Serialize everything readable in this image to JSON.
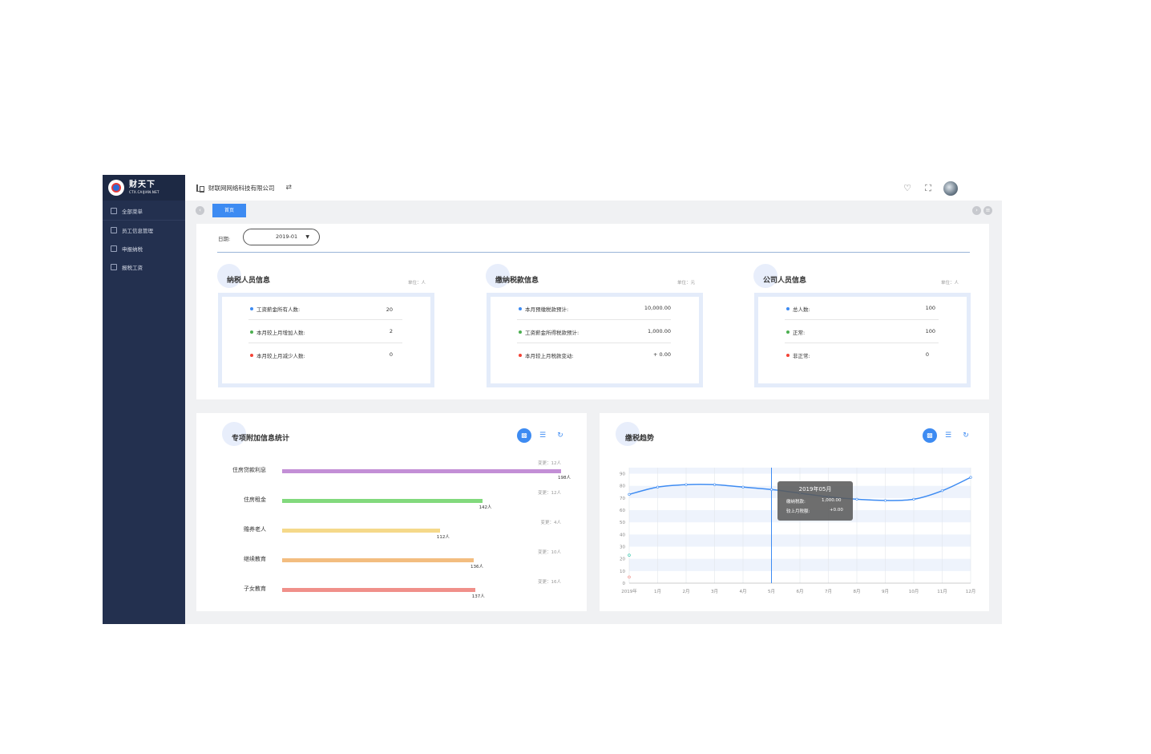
{
  "sidebar": {
    "logo_title": "财天下",
    "logo_sub": "CTX.CAIJIAN.NET",
    "items": [
      {
        "label": "全部菜单"
      },
      {
        "label": "员工信息管理"
      },
      {
        "label": "申报纳税"
      },
      {
        "label": "报税工资"
      }
    ]
  },
  "header": {
    "company": "财联网网络科技有限公司",
    "switch_icon": "⇄",
    "bell_icon": "bell-icon",
    "fullscreen_icon": "fullscreen-icon"
  },
  "tabs": {
    "home": "首页"
  },
  "filter": {
    "date_label": "日期:",
    "date_value": "2019-01"
  },
  "sections": {
    "taxpayers": {
      "title": "纳税人员信息",
      "unit": "单位：人",
      "rows": [
        {
          "label": "工资薪金所有人数:",
          "value": "20",
          "color": "#3d8bf2"
        },
        {
          "label": "本月较上月增加人数:",
          "value": "2",
          "color": "#4caf50"
        },
        {
          "label": "本月较上月减少人数:",
          "value": "0",
          "color": "#f44336"
        }
      ]
    },
    "payments": {
      "title": "缴纳税款信息",
      "unit": "单位：元",
      "rows": [
        {
          "label": "本月预缴税款预计:",
          "value": "10,000.00",
          "color": "#3d8bf2"
        },
        {
          "label": "工资薪金所得税款预计:",
          "value": "1,000.00",
          "color": "#4caf50"
        },
        {
          "label": "本月较上月税款变动:",
          "value": "+ 0.00",
          "color": "#f44336"
        }
      ]
    },
    "staff": {
      "title": "公司人员信息",
      "unit": "单位：人",
      "rows": [
        {
          "label": "总人数:",
          "value": "100",
          "color": "#3d8bf2"
        },
        {
          "label": "正常:",
          "value": "100",
          "color": "#4caf50"
        },
        {
          "label": "非正常:",
          "value": "0",
          "color": "#f44336"
        }
      ]
    }
  },
  "special_stats": {
    "title": "专项附加信息统计",
    "items": [
      {
        "label": "住房贷款利息",
        "value": 198,
        "value_label": "198人",
        "note": "变更：12人",
        "color": "#c38fd6"
      },
      {
        "label": "住房租金",
        "value": 142,
        "value_label": "142人",
        "note": "变更：12人",
        "color": "#82d97d"
      },
      {
        "label": "赡养老人",
        "value": 112,
        "value_label": "112人",
        "note": "变更：4人",
        "color": "#f5d98a"
      },
      {
        "label": "继续教育",
        "value": 136,
        "value_label": "136人",
        "note": "变更：10人",
        "color": "#f3bd80"
      },
      {
        "label": "子女教育",
        "value": 137,
        "value_label": "137人",
        "note": "变更：16人",
        "color": "#f0908a"
      }
    ]
  },
  "trend": {
    "title": "缴税趋势",
    "tooltip": {
      "title": "2019年05月",
      "line1_label": "缴纳税款:",
      "line1_value": "1,000.00",
      "line2_label": "较上月税额:",
      "line2_value": "+0.00"
    }
  },
  "chart_data": [
    {
      "type": "bar",
      "title": "专项附加信息统计",
      "categories": [
        "住房贷款利息",
        "住房租金",
        "赡养老人",
        "继续教育",
        "子女教育"
      ],
      "values": [
        198,
        142,
        112,
        136,
        137
      ],
      "xlim": [
        0,
        198
      ]
    },
    {
      "type": "line",
      "title": "缴税趋势",
      "x": [
        "2019年",
        "1月",
        "2月",
        "3月",
        "4月",
        "5月",
        "6月",
        "7月",
        "8月",
        "9月",
        "10月",
        "11月",
        "12月"
      ],
      "y": [
        73,
        79,
        81,
        81,
        79,
        77,
        74,
        71,
        69,
        68,
        69,
        76,
        87
      ],
      "yticks": [
        0,
        10,
        20,
        30,
        40,
        50,
        60,
        70,
        80,
        90
      ],
      "ylim": [
        0,
        95
      ],
      "grid": true,
      "highlight_x": "5月"
    }
  ]
}
